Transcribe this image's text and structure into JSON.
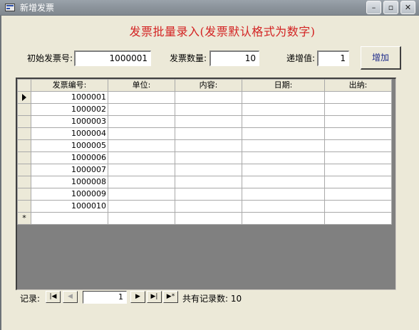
{
  "window": {
    "title": "新增发票",
    "minimize_glyph": "–",
    "restore_glyph": "▫",
    "close_glyph": "✕"
  },
  "form": {
    "title": "发票批量录入(发票默认格式为数字)",
    "start_label": "初始发票号:",
    "start_value": "1000001",
    "count_label": "发票数量:",
    "count_value": "10",
    "step_label": "递增值:",
    "step_value": "1",
    "add_button": "增加"
  },
  "datasheet": {
    "columns": [
      "发票编号:",
      "单位:",
      "内容:",
      "日期:",
      "出纳:"
    ],
    "rows": [
      {
        "invoice_no": "1000001",
        "unit": "",
        "content": "",
        "date": "",
        "cashier": ""
      },
      {
        "invoice_no": "1000002",
        "unit": "",
        "content": "",
        "date": "",
        "cashier": ""
      },
      {
        "invoice_no": "1000003",
        "unit": "",
        "content": "",
        "date": "",
        "cashier": ""
      },
      {
        "invoice_no": "1000004",
        "unit": "",
        "content": "",
        "date": "",
        "cashier": ""
      },
      {
        "invoice_no": "1000005",
        "unit": "",
        "content": "",
        "date": "",
        "cashier": ""
      },
      {
        "invoice_no": "1000006",
        "unit": "",
        "content": "",
        "date": "",
        "cashier": ""
      },
      {
        "invoice_no": "1000007",
        "unit": "",
        "content": "",
        "date": "",
        "cashier": ""
      },
      {
        "invoice_no": "1000008",
        "unit": "",
        "content": "",
        "date": "",
        "cashier": ""
      },
      {
        "invoice_no": "1000009",
        "unit": "",
        "content": "",
        "date": "",
        "cashier": ""
      },
      {
        "invoice_no": "1000010",
        "unit": "",
        "content": "",
        "date": "",
        "cashier": ""
      }
    ],
    "new_row_marker": "*"
  },
  "navigator": {
    "label": "记录:",
    "first_glyph": "|◀",
    "prev_glyph": "◀",
    "current_record": "1",
    "next_glyph": "▶",
    "last_glyph": "▶|",
    "new_glyph": "▶*",
    "total_label": "共有记录数: 10"
  },
  "icons": {
    "app": "form-window-icon",
    "current_row": "current-record-pointer-icon"
  }
}
